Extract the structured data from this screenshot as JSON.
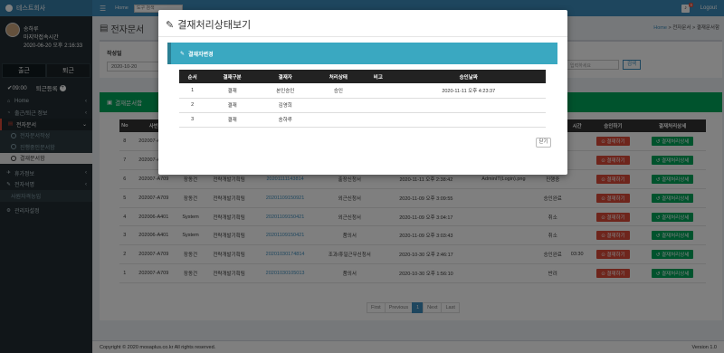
{
  "brand": {
    "name": "테스트회사"
  },
  "user": {
    "name": "송하루",
    "last_login_label": "마지막접속시간",
    "last_login_time": "2020-06-20 오후 2:16:33"
  },
  "attendance": {
    "in_label": "출근",
    "out_label": "퇴근",
    "time": "09:00",
    "leave_label": "퇴근등록"
  },
  "sidebar": {
    "items": [
      {
        "label": "Home"
      },
      {
        "label": "출근/퇴근 정보"
      },
      {
        "label": "전자문서"
      },
      {
        "label": "전자문서작성"
      },
      {
        "label": "진행중인문서함"
      },
      {
        "label": "결재문서함"
      },
      {
        "label": "휴가정보"
      },
      {
        "label": "전자석명"
      },
      {
        "label": "사원자격능입"
      },
      {
        "label": "관리자설정"
      }
    ]
  },
  "topbar": {
    "home": "Home",
    "search_placeholder": "도구 검색",
    "badge": "0",
    "logout": "Logout"
  },
  "page": {
    "title": "전자문서",
    "breadcrumb_home": "Home",
    "breadcrumb_rest": " > 전자문서 > 결재문서함"
  },
  "filter": {
    "label": "작성일",
    "date": "2020-10-20",
    "input_placeholder": "입력하세요",
    "search_label": "검색"
  },
  "list": {
    "header": "결재문서함",
    "columns": [
      "No",
      "사번",
      "작성자",
      "부서",
      "문서번호",
      "문서명",
      "작성일",
      "첨부파일",
      "상태",
      "시간",
      "승인하기",
      "결재처리상세"
    ],
    "rows": [
      {
        "no": "8",
        "emp": "202007-A709",
        "name": "장동건",
        "dept": "전략개발기획팀",
        "doc": "20201111143814",
        "title": "출장신청서",
        "date": "2020-11-11 오후 2:38:42",
        "file": "",
        "status": "승인",
        "status_class": "st-approved",
        "time": ""
      },
      {
        "no": "7",
        "emp": "202007-A709",
        "name": "장동건",
        "dept": "전략개발기획팀",
        "doc": "20201111143814",
        "title": "출장신청서",
        "date": "2020-11-11 오후 2:38:42",
        "file": "",
        "status": "승인완료",
        "status_class": "st-approved",
        "time": ""
      },
      {
        "no": "6",
        "emp": "202007-A709",
        "name": "장동건",
        "dept": "전략개발기획팀",
        "doc": "20201111143814",
        "title": "출장신청서",
        "date": "2020-11-11 오후 2:38:42",
        "file": "AdminIT(Login).png",
        "status": "진행중",
        "status_class": "st-blue",
        "time": ""
      },
      {
        "no": "5",
        "emp": "202007-A709",
        "name": "장동건",
        "dept": "전략개발기획팀",
        "doc": "20201109150921",
        "title": "외근신청서",
        "date": "2020-11-09 오후 3:09:55",
        "file": "",
        "status": "승인완료",
        "status_class": "st-approved",
        "time": ""
      },
      {
        "no": "4",
        "emp": "202006-A401",
        "name": "System",
        "dept": "전략개발기획팀",
        "doc": "20201109150421",
        "title": "외근신청서",
        "date": "2020-11-09 오후 3:04:17",
        "file": "",
        "status": "취소",
        "status_class": "st-cancel",
        "time": ""
      },
      {
        "no": "3",
        "emp": "202006-A401",
        "name": "System",
        "dept": "전략개발기획팀",
        "doc": "20201109150421",
        "title": "품의서",
        "date": "2020-11-09 오후 3:03:43",
        "file": "",
        "status": "취소",
        "status_class": "st-cancel",
        "time": ""
      },
      {
        "no": "2",
        "emp": "202007-A709",
        "name": "장동건",
        "dept": "전략개발기획팀",
        "doc": "20201030174814",
        "title": "조과/휴일근무신청서",
        "date": "2020-10-30 오후 2:46:17",
        "file": "",
        "status": "승인완료",
        "status_class": "st-approved",
        "time": "03:30"
      },
      {
        "no": "1",
        "emp": "202007-A709",
        "name": "장동건",
        "dept": "전략개발기획팀",
        "doc": "20201030105013",
        "title": "품의서",
        "date": "2020-10-30 오후 1:56:10",
        "file": "",
        "status": "반려",
        "status_class": "st-pending",
        "time": ""
      }
    ],
    "approve_label": "결재하기",
    "detail_label": "결재처리상세"
  },
  "pagination": {
    "first": "First",
    "previous": "Previous",
    "page": "1",
    "next": "Next",
    "last": "Last"
  },
  "footer": {
    "copyright": "Copyright © 2020 mosaplus.co.kr All rights reserved.",
    "version": "Version 1.0"
  },
  "modal": {
    "title": "결재처리상태보기",
    "panel_title": "결재자변경",
    "columns": [
      "순서",
      "결재구분",
      "결재자",
      "처리상태",
      "비고",
      "승인날짜"
    ],
    "rows": [
      {
        "order": "1",
        "type": "결재",
        "approver": "본인승인",
        "status": "승인",
        "note": "",
        "date": "2020-11-11 오후 4:23:37"
      },
      {
        "order": "2",
        "type": "결재",
        "approver": "김영희",
        "status": "",
        "note": "",
        "date": ""
      },
      {
        "order": "3",
        "type": "결재",
        "approver": "송하루",
        "status": "",
        "note": "",
        "date": ""
      }
    ],
    "close_label": "닫기"
  },
  "colors": {
    "sidebar": "#222d32",
    "topbar": "#3c8dbc",
    "success": "#00a65a",
    "danger": "#dd4b39",
    "panel": "#3aa8c1"
  }
}
